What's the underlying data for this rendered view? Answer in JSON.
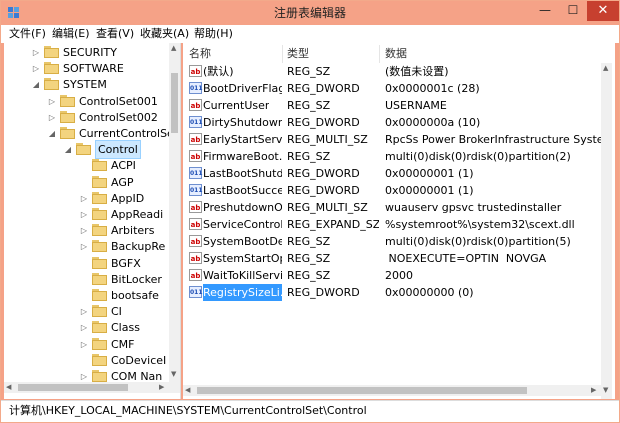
{
  "window": {
    "title": "注册表编辑器",
    "min_label": "—",
    "max_label": "☐",
    "close_label": "✕"
  },
  "menu": [
    "文件(F)",
    "编辑(E)",
    "查看(V)",
    "收藏夹(A)",
    "帮助(H)"
  ],
  "tree": {
    "items": [
      {
        "label": "SECURITY",
        "expanded": false
      },
      {
        "label": "SOFTWARE",
        "expanded": false
      },
      {
        "label": "SYSTEM",
        "expanded": true
      },
      {
        "label": "ControlSet001",
        "expanded": false
      },
      {
        "label": "ControlSet002",
        "expanded": false
      },
      {
        "label": "CurrentControlSe",
        "expanded": true
      },
      {
        "label": "Control",
        "expanded": true,
        "selected": true
      },
      {
        "label": "ACPI",
        "expanded": null
      },
      {
        "label": "AGP",
        "expanded": null
      },
      {
        "label": "AppID",
        "expanded": false
      },
      {
        "label": "AppReadi",
        "expanded": false
      },
      {
        "label": "Arbiters",
        "expanded": false
      },
      {
        "label": "BackupRe",
        "expanded": false
      },
      {
        "label": "BGFX",
        "expanded": null
      },
      {
        "label": "BitLocker",
        "expanded": null
      },
      {
        "label": "bootsafe",
        "expanded": null
      },
      {
        "label": "CI",
        "expanded": false
      },
      {
        "label": "Class",
        "expanded": false
      },
      {
        "label": "CMF",
        "expanded": false
      },
      {
        "label": "CoDeviceI",
        "expanded": null
      },
      {
        "label": "COM Nan",
        "expanded": false
      }
    ]
  },
  "list": {
    "columns": [
      "名称",
      "类型",
      "数据"
    ],
    "rows": [
      {
        "icon": "ab",
        "name": "(默认)",
        "type": "REG_SZ",
        "data": "(数值未设置)"
      },
      {
        "icon": "bin",
        "name": "BootDriverFlags",
        "type": "REG_DWORD",
        "data": "0x0000001c (28)"
      },
      {
        "icon": "ab",
        "name": "CurrentUser",
        "type": "REG_SZ",
        "data": "USERNAME"
      },
      {
        "icon": "bin",
        "name": "DirtyShutdown…",
        "type": "REG_DWORD",
        "data": "0x0000000a (10)"
      },
      {
        "icon": "ab",
        "name": "EarlyStartServi…",
        "type": "REG_MULTI_SZ",
        "data": "RpcSs Power BrokerInfrastructure SystemEve…"
      },
      {
        "icon": "ab",
        "name": "FirmwareBoot…",
        "type": "REG_SZ",
        "data": "multi(0)disk(0)rdisk(0)partition(2)"
      },
      {
        "icon": "bin",
        "name": "LastBootShutd…",
        "type": "REG_DWORD",
        "data": "0x00000001 (1)"
      },
      {
        "icon": "bin",
        "name": "LastBootSucce…",
        "type": "REG_DWORD",
        "data": "0x00000001 (1)"
      },
      {
        "icon": "ab",
        "name": "PreshutdownO…",
        "type": "REG_MULTI_SZ",
        "data": "wuauserv gpsvc trustedinstaller"
      },
      {
        "icon": "ab",
        "name": "ServiceControl…",
        "type": "REG_EXPAND_SZ",
        "data": "%systemroot%\\system32\\scext.dll"
      },
      {
        "icon": "ab",
        "name": "SystemBootDe…",
        "type": "REG_SZ",
        "data": "multi(0)disk(0)rdisk(0)partition(5)"
      },
      {
        "icon": "ab",
        "name": "SystemStartOp…",
        "type": "REG_SZ",
        "data": " NOEXECUTE=OPTIN  NOVGA"
      },
      {
        "icon": "ab",
        "name": "WaitToKillServi…",
        "type": "REG_SZ",
        "data": "2000"
      },
      {
        "icon": "bin",
        "name": "RegistrySizeLi…",
        "type": "REG_DWORD",
        "data": "0x00000000 (0)",
        "selected": true
      }
    ]
  },
  "status": "计算机\\HKEY_LOCAL_MACHINE\\SYSTEM\\CurrentControlSet\\Control",
  "colors": {
    "titlebar": "#f5a287",
    "close": "#c7402f",
    "selection": "#3399ff",
    "tree_selection": "#cce8ff"
  },
  "icons": {
    "app": "registry-cube-icon",
    "folder": "folder-icon",
    "string_value": "ab-string-icon",
    "binary_value": "binary-value-icon"
  }
}
